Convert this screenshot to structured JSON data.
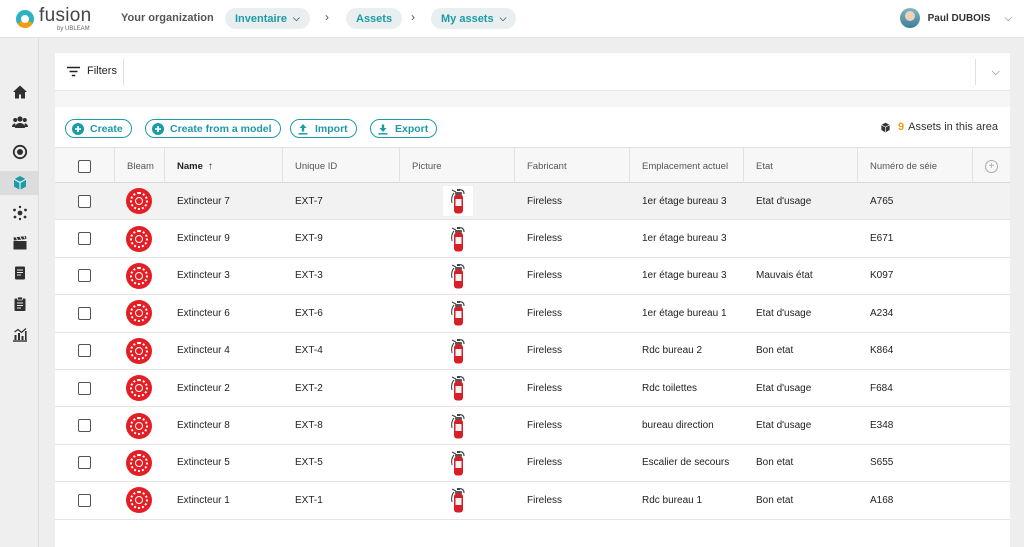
{
  "header": {
    "logo_word": "fusion",
    "logo_sub": "by UBLEAM",
    "org_label": "Your organization",
    "breadcrumb": [
      {
        "label": "Inventaire",
        "has_dropdown": true
      },
      {
        "label": "Assets",
        "has_dropdown": false
      },
      {
        "label": "My assets",
        "has_dropdown": true
      }
    ],
    "user_name": "Paul DUBOIS"
  },
  "sidebar": {
    "items": [
      {
        "icon": "home-icon",
        "active": false
      },
      {
        "icon": "users-icon",
        "active": false
      },
      {
        "icon": "bleam-target-icon",
        "active": false
      },
      {
        "icon": "cube-icon",
        "active": true
      },
      {
        "icon": "network-icon",
        "active": false
      },
      {
        "icon": "clapperboard-icon",
        "active": false
      },
      {
        "icon": "document-icon",
        "active": false
      },
      {
        "icon": "clipboard-icon",
        "active": false
      },
      {
        "icon": "analytics-icon",
        "active": false
      }
    ]
  },
  "filters": {
    "label": "Filters"
  },
  "actions": {
    "create": "Create",
    "create_model": "Create from a model",
    "import": "Import",
    "export": "Export",
    "count_value": "9",
    "count_label": "Assets in this area"
  },
  "table": {
    "columns": {
      "bleam": "Bleam",
      "name": "Name",
      "uid": "Unique ID",
      "picture": "Picture",
      "fabricant": "Fabricant",
      "emplacement": "Emplacement actuel",
      "etat": "Etat",
      "numero": "Numéro de séie"
    },
    "sort": {
      "column": "name",
      "direction": "ascending",
      "arrow": "↑"
    },
    "rows": [
      {
        "name": "Extincteur 7",
        "uid": "EXT-7",
        "fabricant": "Fireless",
        "emplacement": "1er étage bureau 3",
        "etat": "Etat d'usage",
        "numero": "A765"
      },
      {
        "name": "Extincteur 9",
        "uid": "EXT-9",
        "fabricant": "Fireless",
        "emplacement": "1er étage bureau 3",
        "etat": "",
        "numero": "E671"
      },
      {
        "name": "Extincteur 3",
        "uid": "EXT-3",
        "fabricant": "Fireless",
        "emplacement": "1er étage bureau 3",
        "etat": "Mauvais état",
        "numero": "K097"
      },
      {
        "name": "Extincteur 6",
        "uid": "EXT-6",
        "fabricant": "Fireless",
        "emplacement": "1er étage bureau 1",
        "etat": "Etat d'usage",
        "numero": "A234"
      },
      {
        "name": "Extincteur 4",
        "uid": "EXT-4",
        "fabricant": "Fireless",
        "emplacement": "Rdc bureau 2",
        "etat": "Bon etat",
        "numero": "K864"
      },
      {
        "name": "Extincteur 2",
        "uid": "EXT-2",
        "fabricant": "Fireless",
        "emplacement": "Rdc toilettes",
        "etat": "Etat d'usage",
        "numero": "F684"
      },
      {
        "name": "Extincteur 8",
        "uid": "EXT-8",
        "fabricant": "Fireless",
        "emplacement": "bureau direction",
        "etat": "Etat d'usage",
        "numero": "E348"
      },
      {
        "name": "Extincteur 5",
        "uid": "EXT-5",
        "fabricant": "Fireless",
        "emplacement": "Escalier de secours",
        "etat": "Bon etat",
        "numero": "S655"
      },
      {
        "name": "Extincteur 1",
        "uid": "EXT-1",
        "fabricant": "Fireless",
        "emplacement": "Rdc bureau 1",
        "etat": "Bon etat",
        "numero": "A168"
      }
    ]
  },
  "colors": {
    "accent": "#1e9aa6",
    "count_highlight": "#f39c12",
    "bleam_red": "#e31e24"
  }
}
